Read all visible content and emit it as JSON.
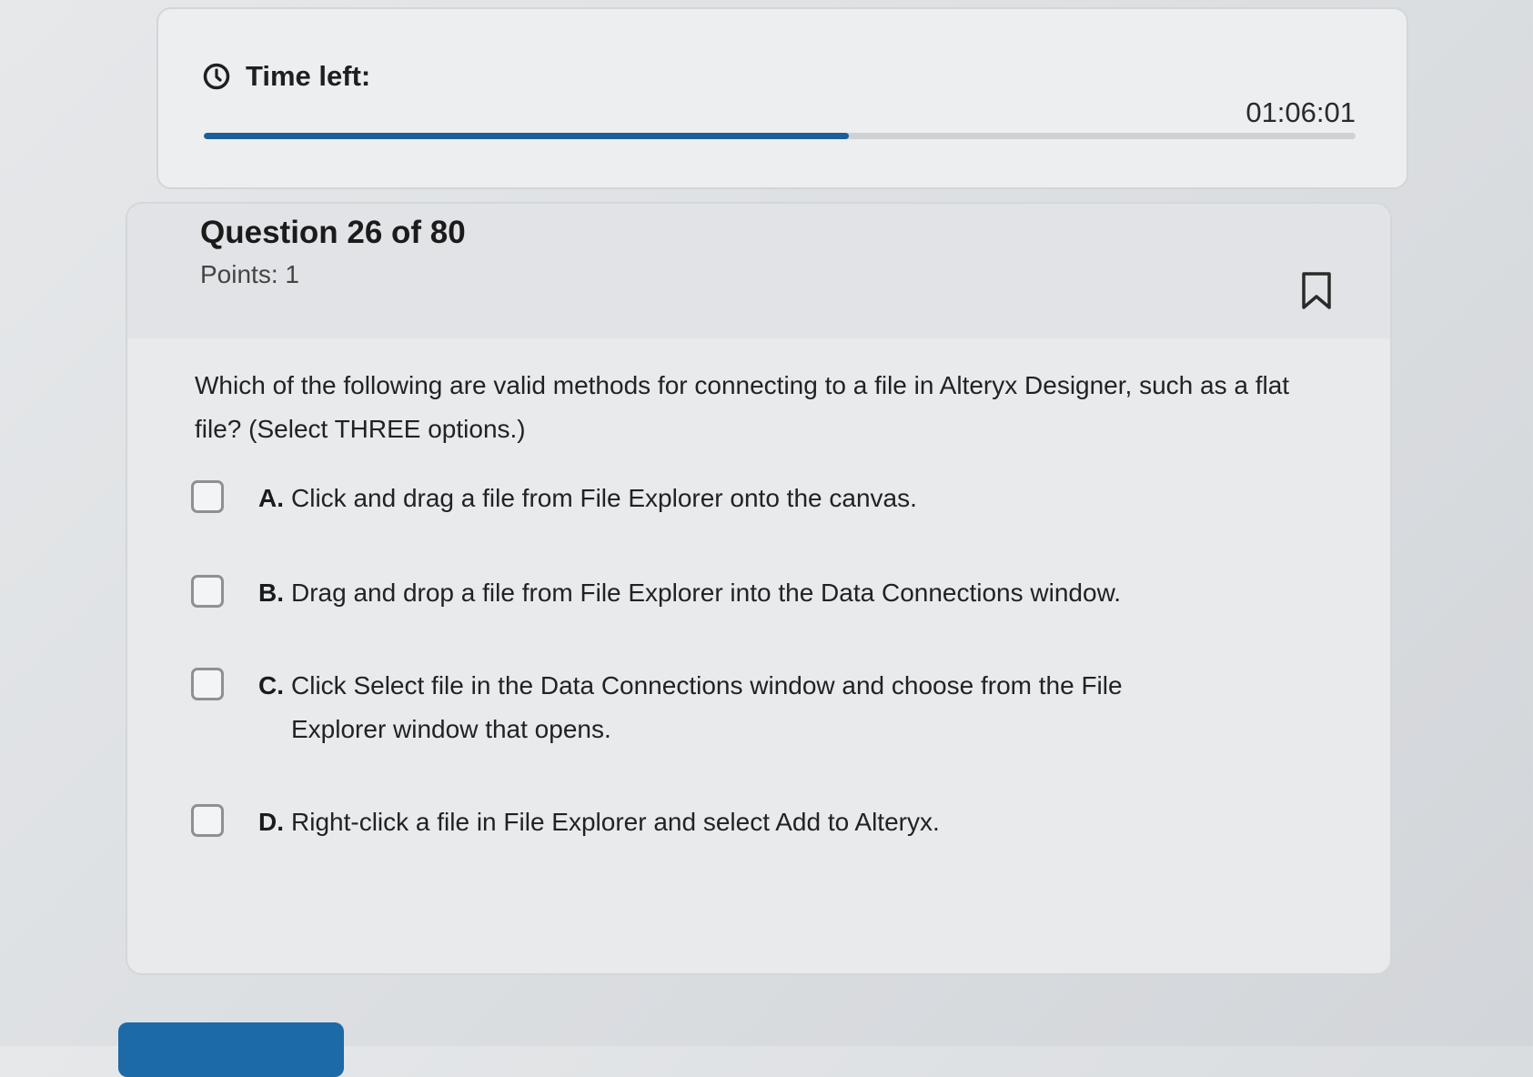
{
  "timer": {
    "label": "Time left:",
    "value": "01:06:01",
    "progress_fraction": 0.56,
    "icon": "clock-icon"
  },
  "question": {
    "number_label": "Question 26 of 80",
    "points_label": "Points: 1",
    "text": "Which of the following are valid methods for connecting to a file in Alteryx Designer, such as a flat file? (Select THREE options.)",
    "bookmark_icon": "bookmark-icon",
    "options": [
      {
        "letter": "A.",
        "text": "Click and drag a file from File Explorer onto the canvas."
      },
      {
        "letter": "B.",
        "text": "Drag and drop a file from File Explorer into the Data Connections window."
      },
      {
        "letter": "C.",
        "text": "Click Select file in the Data Connections window and choose from the File Explorer window that opens."
      },
      {
        "letter": "D.",
        "text": "Right-click a file in File Explorer and select Add to Alteryx."
      }
    ]
  },
  "colors": {
    "accent": "#1a5f9a",
    "button": "#1c6aa8"
  }
}
